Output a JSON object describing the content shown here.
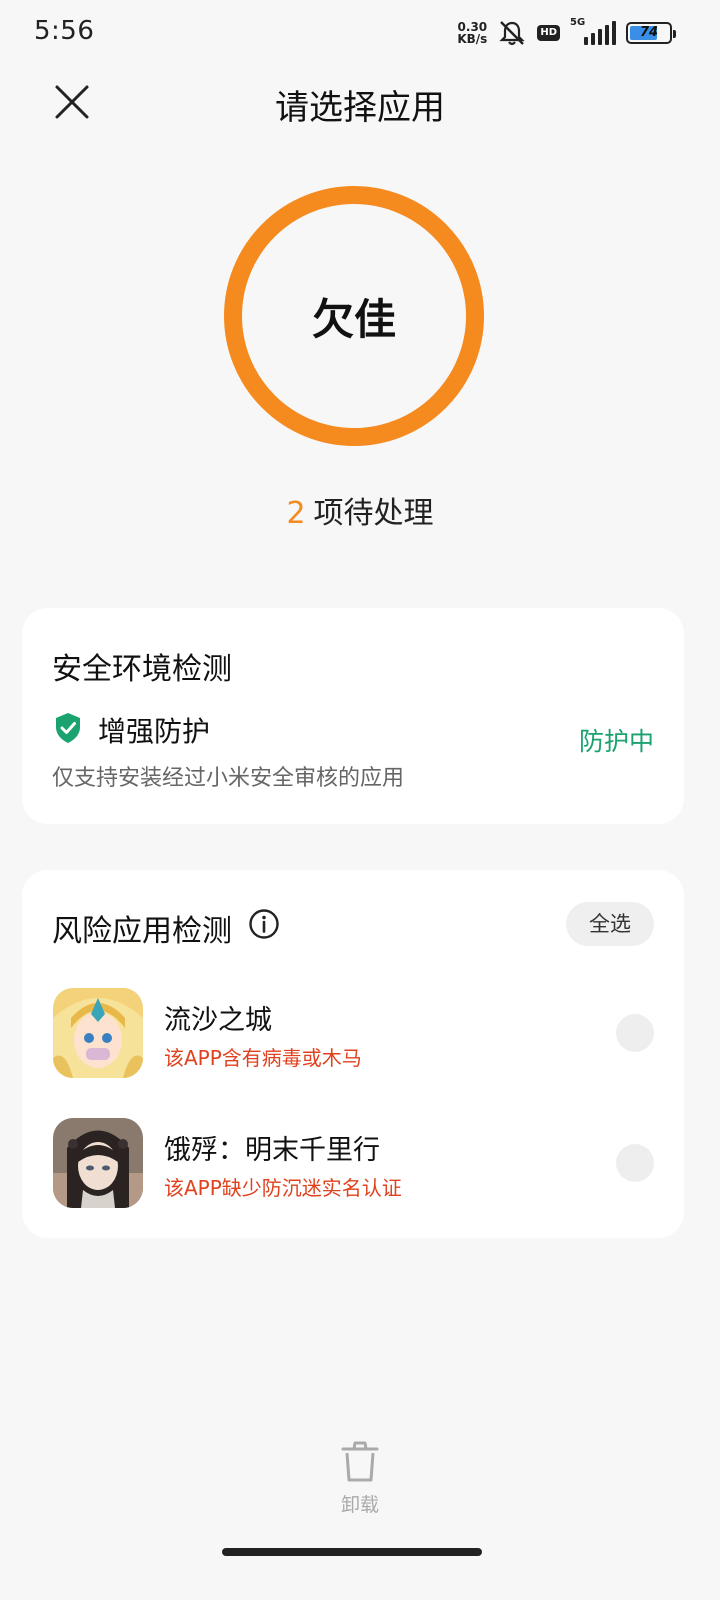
{
  "status_bar": {
    "time": "5:56",
    "net_speed_value": "0.30",
    "net_speed_unit": "KB/s",
    "hd_label": "HD",
    "network_label": "5G",
    "battery_percent": "74",
    "battery_level": 0.74,
    "battery_fill_color": "#3a8ee6"
  },
  "header": {
    "title": "请选择应用",
    "close_icon": "close-icon"
  },
  "score": {
    "label": "欠佳",
    "ring_color": "#f58a1f",
    "pending_count": "2",
    "pending_text": "项待处理"
  },
  "environment_card": {
    "title": "安全环境检测",
    "item_label": "增强防护",
    "item_icon": "shield-check-icon",
    "item_description": "仅支持安装经过小米安全审核的应用",
    "status": "防护中",
    "status_color": "#1aa36f"
  },
  "risk_card": {
    "title": "风险应用检测",
    "info_icon": "info-icon",
    "select_all_label": "全选",
    "apps": [
      {
        "name": "流沙之城",
        "warning": "该APP含有病毒或木马"
      },
      {
        "name": "饿殍：明末千里行",
        "warning": "该APP缺少防沉迷实名认证"
      }
    ],
    "warning_color": "#e0421f"
  },
  "bottom_bar": {
    "uninstall_label": "卸载",
    "uninstall_icon": "trash-icon"
  }
}
